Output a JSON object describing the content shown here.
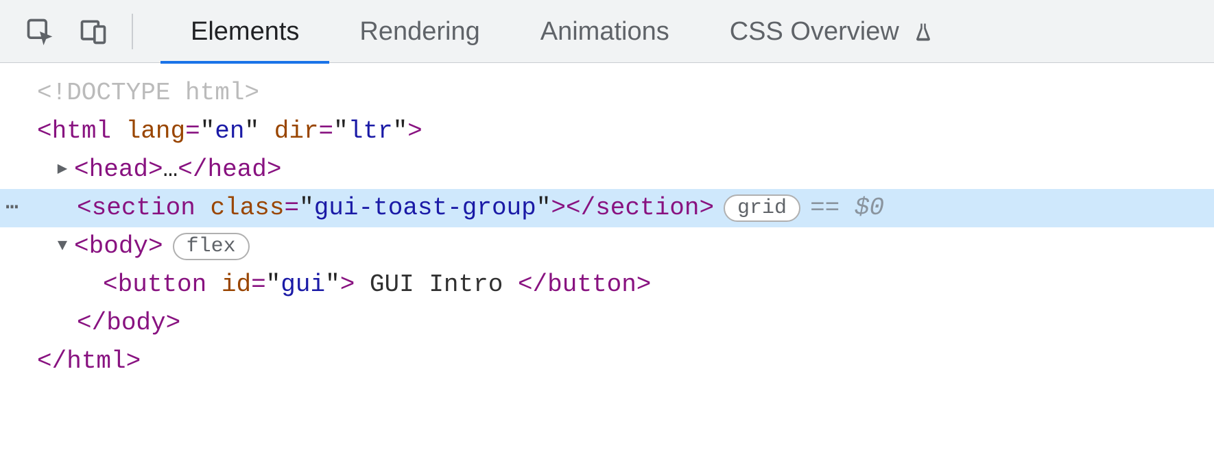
{
  "toolbar": {
    "tabs": [
      "Elements",
      "Rendering",
      "Animations",
      "CSS Overview"
    ]
  },
  "dom": {
    "doctype": "<!DOCTYPE html>",
    "html_open_prefix": "<",
    "html_tag": "html",
    "html_attr_lang_name": "lang",
    "html_attr_lang_value": "en",
    "html_attr_dir_name": "dir",
    "html_attr_dir_value": "ltr",
    "head_tag": "head",
    "head_ellipsis": "…",
    "section_tag": "section",
    "section_class_name": "class",
    "section_class_value": "gui-toast-group",
    "section_badge": "grid",
    "section_ref": "$0",
    "body_tag": "body",
    "body_badge": "flex",
    "button_tag": "button",
    "button_id_name": "id",
    "button_id_value": "gui",
    "button_text": " GUI Intro "
  }
}
